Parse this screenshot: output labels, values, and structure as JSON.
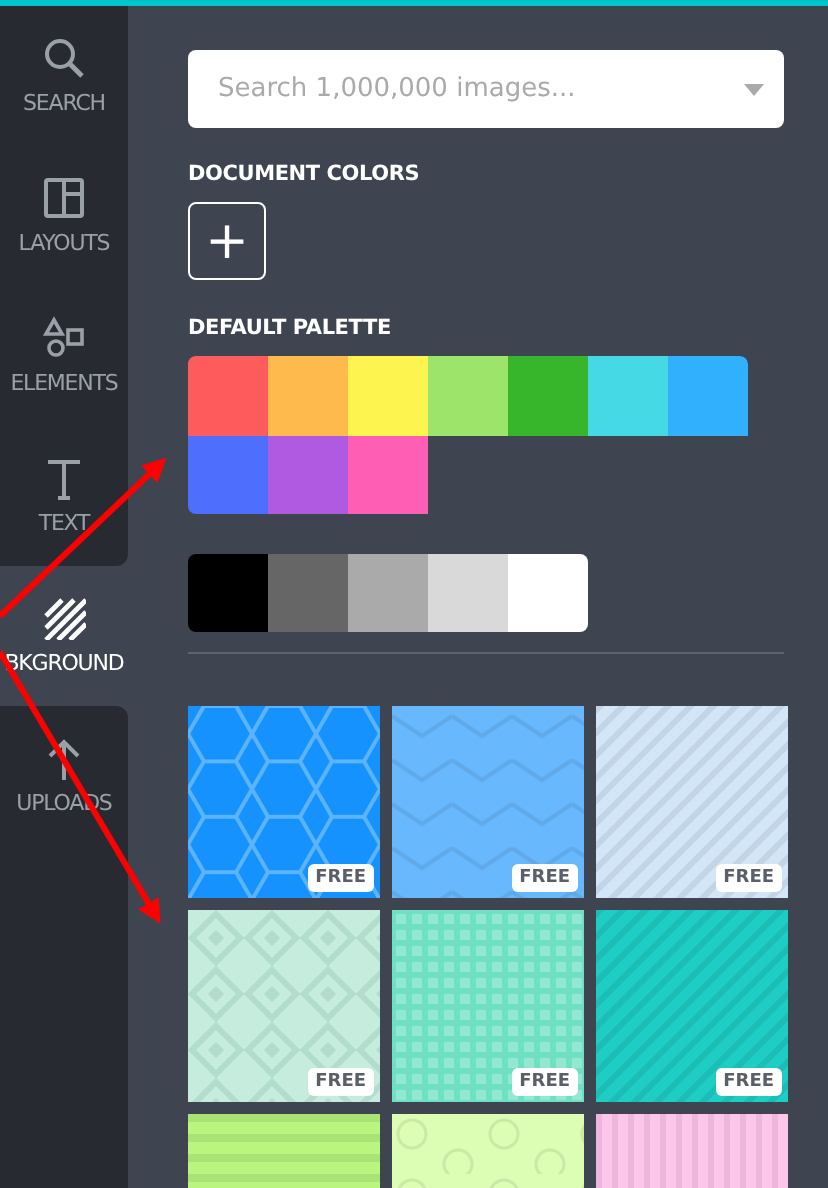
{
  "sidebar": {
    "items": [
      {
        "kind": "search",
        "label": "SEARCH",
        "selected": false
      },
      {
        "kind": "layouts",
        "label": "LAYOUTS",
        "selected": false
      },
      {
        "kind": "elements",
        "label": "ELEMENTS",
        "selected": false
      },
      {
        "kind": "text",
        "label": "TEXT",
        "selected": false
      },
      {
        "kind": "background",
        "label": "BKGROUND",
        "selected": true
      },
      {
        "kind": "uploads",
        "label": "UPLOADS",
        "selected": false
      }
    ]
  },
  "search": {
    "placeholder": "Search 1,000,000 images..."
  },
  "document_colors": {
    "title": "DOCUMENT COLORS",
    "add_button": "+"
  },
  "default_palette": {
    "title": "DEFAULT PALETTE",
    "colors": [
      {
        "color": "#fe5c5c"
      },
      {
        "color": "#feba4c"
      },
      {
        "color": "#fef44f"
      },
      {
        "color": "#9de46a"
      },
      {
        "color": "#37b62c"
      },
      {
        "color": "#45d9e6"
      },
      {
        "color": "#31b0fe"
      },
      {
        "color": "#4e6efe"
      },
      {
        "color": "#b05ae2"
      },
      {
        "color": "#fe5fb4"
      }
    ],
    "greys": [
      {
        "color": "#000000"
      },
      {
        "color": "#666666"
      },
      {
        "color": "#aaaaaa"
      },
      {
        "color": "#d9d9d9"
      },
      {
        "color": "#ffffff"
      }
    ]
  },
  "backgrounds": [
    {
      "kind": "hexagon",
      "color": "#1592fe",
      "badge": "FREE"
    },
    {
      "kind": "chevron",
      "color": "#68b8fd",
      "badge": "FREE"
    },
    {
      "kind": "diagonal",
      "color": "#d3e6f8",
      "badge": "FREE"
    },
    {
      "kind": "diamond",
      "color": "#c6ecde",
      "badge": "FREE"
    },
    {
      "kind": "grid",
      "color": "#6fe0c3",
      "badge": "FREE"
    },
    {
      "kind": "diagonal",
      "color": "#1ecdc3",
      "badge": "FREE"
    },
    {
      "kind": "stripes",
      "color": "#b9f57f"
    },
    {
      "kind": "circles",
      "color": "#dbfdb4"
    },
    {
      "kind": "vertical",
      "color": "#fbc6ea"
    }
  ]
}
